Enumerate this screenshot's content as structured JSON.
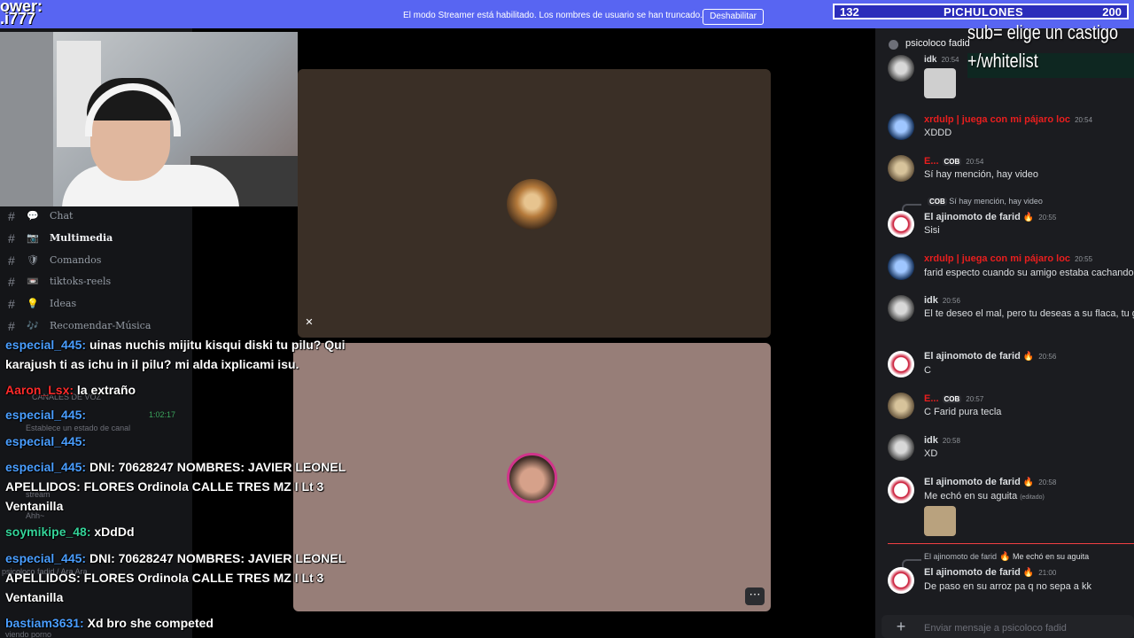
{
  "banner": {
    "message": "El modo Streamer está habilitado. Los nombres de usuario se han truncado.",
    "disable_label": "Deshabilitar",
    "corner_overlay": "ower:\n.i777"
  },
  "counter": {
    "left": "132",
    "title": "PICHULONES",
    "right": "200"
  },
  "sub_overlay": {
    "line1": "sub= elige un castigo",
    "line2": "+/whitelist"
  },
  "channels": [
    {
      "icon": "💬",
      "label": "Chat",
      "active": false
    },
    {
      "icon": "📷",
      "label": "Multimedia",
      "active": true
    },
    {
      "icon": "🛡",
      "label": "Comandos",
      "active": false
    },
    {
      "icon": "📼",
      "label": "tiktoks-reels",
      "active": false
    },
    {
      "icon": "💡",
      "label": "Ideas",
      "active": false
    },
    {
      "icon": "🎶",
      "label": "Recomendar-Música",
      "active": false
    }
  ],
  "sidebar_ghost": {
    "voice_header": "CANALES DE VOZ",
    "voice_time": "1:02:17",
    "status": "Establece un estado de canal",
    "stream": "stream",
    "ahh": "Ahh~",
    "bottom": "viendo porno",
    "user": "psicoloco fadid / Ara Ara"
  },
  "twitch_chat": [
    {
      "user": "especial_445",
      "color": "#4a9eff",
      "lines": [
        "uinas nuchis mijitu kisqui diski tu pilu? Qui",
        "karajush ti as ichu in il pilu? mi alda ixplicami isu."
      ]
    },
    {
      "user": "Aaron_Lsx",
      "color": "#ff2b2b",
      "lines": [
        "la extraño"
      ]
    },
    {
      "user": "especial_445",
      "color": "#4a9eff",
      "lines": [
        ""
      ]
    },
    {
      "user": "especial_445",
      "color": "#4a9eff",
      "lines": [
        ""
      ]
    },
    {
      "user": "especial_445",
      "color": "#4a9eff",
      "lines": [
        "DNI: 70628247 NOMBRES: JAVIER LEONEL",
        "APELLIDOS: FLORES Ordinola CALLE TRES MZ I Lt 3",
        "Ventanilla"
      ]
    },
    {
      "user": "soymikipe_48",
      "color": "#34d399",
      "lines": [
        "xDdDd"
      ]
    },
    {
      "user": "especial_445",
      "color": "#4a9eff",
      "lines": [
        "DNI: 70628247 NOMBRES: JAVIER LEONEL",
        "APELLIDOS: FLORES Ordinola CALLE TRES MZ I Lt 3",
        "Ventanilla"
      ]
    },
    {
      "user": "bastiam3631",
      "color": "#4a9eff",
      "lines": [
        "Xd bro she competed"
      ]
    }
  ],
  "right_panel": {
    "channel_name": "psicoloco fadid",
    "composer_placeholder": "Enviar mensaje a psicoloco fadid",
    "messages": [
      {
        "name": "idk",
        "time": "20:54",
        "text": "",
        "avatar": "idk",
        "red": false
      },
      {
        "name": "xrdulp | juega con mi pájaro loc",
        "time": "20:54",
        "text": "XDDD",
        "avatar": "blue",
        "red": true
      },
      {
        "name": "E...",
        "badge": "COB",
        "time": "20:54",
        "text": "Sí hay mención, hay video",
        "avatar": "cat",
        "red": true
      },
      {
        "reply": "Sí hay mención, hay video",
        "reply_badge": "COB",
        "name": "El ajinomoto de farid",
        "time": "20:55",
        "text": "Sisi",
        "avatar": "red",
        "red": false,
        "fire": true
      },
      {
        "name": "xrdulp | juega con mi pájaro loc",
        "time": "20:55",
        "text": "farid especto cuando su amigo estaba cachando",
        "avatar": "blue",
        "red": true
      },
      {
        "name": "idk",
        "time": "20:56",
        "text": "El te deseo el mal, pero tu deseas a su flaca, tu g",
        "avatar": "idk",
        "red": false
      },
      {
        "name": "El ajinomoto de farid",
        "time": "20:56",
        "text": "C",
        "avatar": "red",
        "red": false,
        "fire": true
      },
      {
        "name": "E...",
        "badge": "COB",
        "time": "20:57",
        "text": "C Farid pura tecla",
        "avatar": "cat",
        "red": true
      },
      {
        "name": "idk",
        "time": "20:58",
        "text": "XD",
        "avatar": "idk",
        "red": false
      },
      {
        "name": "El ajinomoto de farid",
        "time": "20:58",
        "text": "Me echó en su aguita",
        "edited": "(editado)",
        "avatar": "red",
        "red": false,
        "fire": true
      },
      {
        "reply": "Me echó en su aguita",
        "reply_name": "El ajinomoto de farid",
        "name": "El ajinomoto de farid",
        "time": "21:00",
        "text": "De paso en su arroz pa q no sepa a kk",
        "avatar": "red",
        "red": false,
        "fire": true
      }
    ]
  },
  "colors": {
    "banner": "#5865f2",
    "counter_bg": "#2b2dbb",
    "stage_top": "#3a2f26",
    "stage_bottom": "#977e78",
    "mention_red": "#e91e1e"
  }
}
